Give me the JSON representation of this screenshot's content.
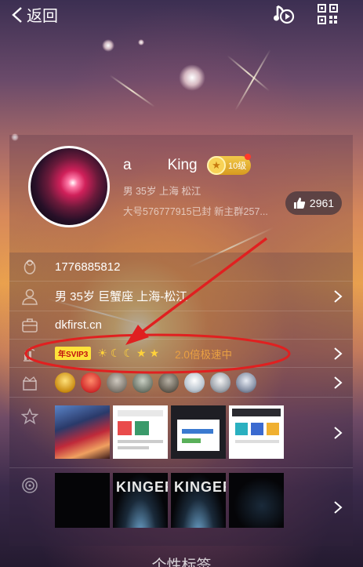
{
  "header": {
    "back_label": "返回",
    "music_icon": "music-note-play-icon",
    "qr_icon": "qr-code-icon"
  },
  "profile": {
    "nickname_part1": "a",
    "nickname_part2": "King",
    "vip_level_label": "10级",
    "subinfo": "男  35岁  上海  松江",
    "signature": "大号576777915已封 新主群257...",
    "likes": "2961"
  },
  "rows": {
    "qq_number": "1776885812",
    "personal_info": "男 35岁 巨蟹座 上海-松江",
    "website": "dkfirst.cn",
    "vip_tag": "年SVIP3",
    "level_icons": [
      "sun-icon",
      "moon-icon",
      "moon-icon",
      "star-icon",
      "star-icon"
    ],
    "speed_text": "2.0倍极速中",
    "medal_icons": [
      "gold-medal-icon",
      "lv5-medal-icon",
      "medal-icon",
      "medal-icon",
      "medal-icon",
      "diamond-icon",
      "shield-icon",
      "star-badge-icon"
    ],
    "photo_texts": [
      "KINGER",
      "KINGER"
    ]
  },
  "bottom": {
    "title": "个性标签"
  },
  "colors": {
    "accent_orange": "#e9a043",
    "annotation_red": "#e02020",
    "vip_gold": "#f2c94a"
  }
}
